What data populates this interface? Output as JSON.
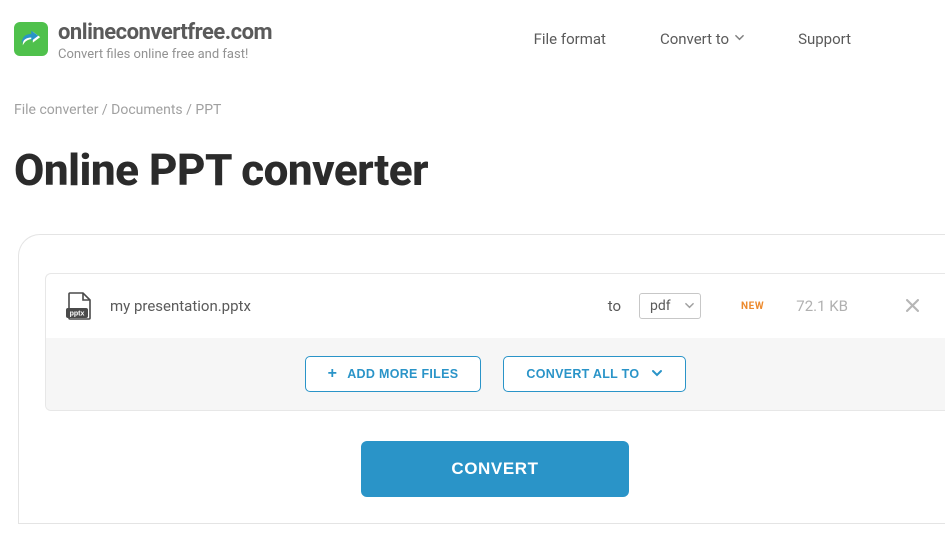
{
  "brand": {
    "title": "onlineconvertfree.com",
    "tagline": "Convert files online free and fast!"
  },
  "nav": {
    "file_format": "File format",
    "convert_to": "Convert to",
    "support": "Support"
  },
  "breadcrumb": {
    "root": "File converter",
    "category": "Documents",
    "current": "PPT"
  },
  "page": {
    "title": "Online PPT converter"
  },
  "files": [
    {
      "icon_ext": "pptx",
      "name": "my presentation.pptx",
      "to_label": "to",
      "target_format": "pdf",
      "badge": "NEW",
      "size": "72.1 KB"
    }
  ],
  "actions": {
    "add_more": "ADD MORE FILES",
    "convert_all_to": "CONVERT ALL TO"
  },
  "cta": {
    "convert": "CONVERT"
  }
}
